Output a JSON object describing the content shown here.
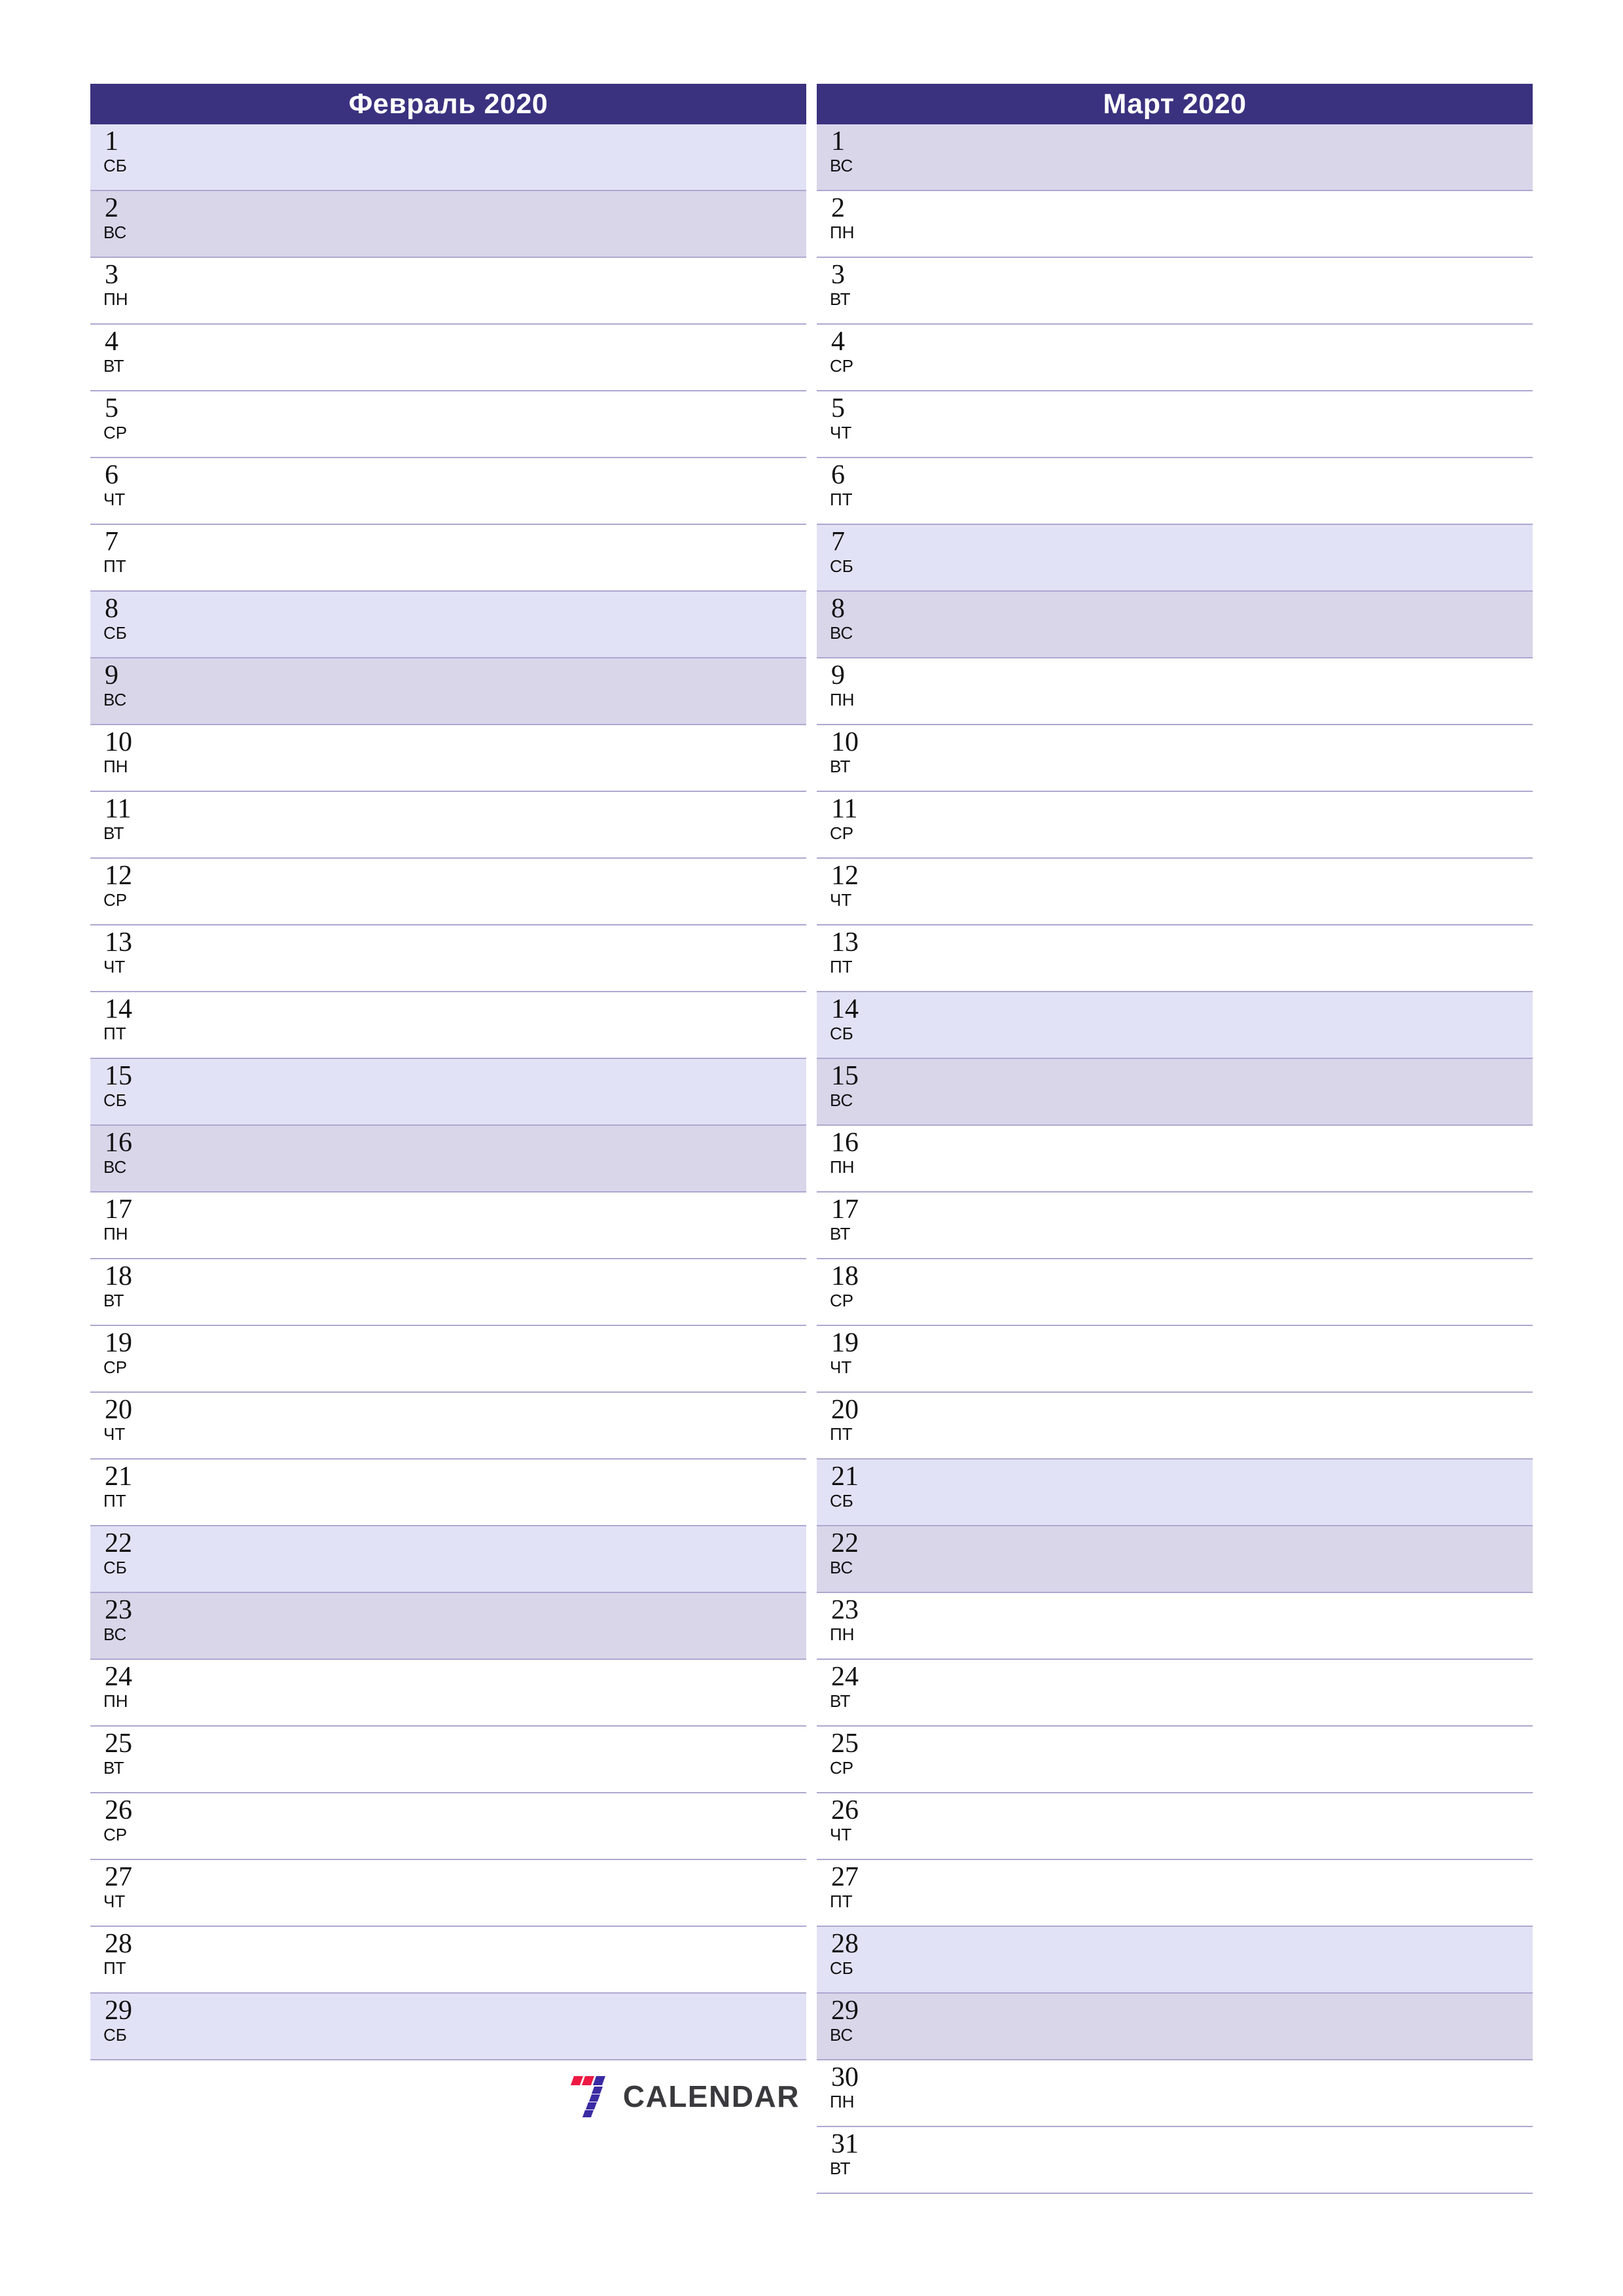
{
  "page": {
    "orientation": "portrait",
    "background_color": "#FFFFFF"
  },
  "theme": {
    "header_background": "#3A327F",
    "header_text_color": "#FFFFFF",
    "saturday_background": "#E2E2F6",
    "sunday_background": "#D9D6EA",
    "weekday_background": "#FFFFFF",
    "row_separator_color": "#ADA8CF",
    "day_text_color": "#111111",
    "logo_red": "#ED1944",
    "logo_purple": "#3B2BA3",
    "logo_word_color": "#3A3A3E"
  },
  "brand": {
    "mark_icon": "seven-stripes-icon",
    "word": "CALENDAR"
  },
  "months": [
    {
      "title": "Февраль 2020",
      "month_name": "Февраль",
      "year": "2020",
      "days": [
        {
          "num": "1",
          "dow": "СБ",
          "type": "sat"
        },
        {
          "num": "2",
          "dow": "ВС",
          "type": "sun"
        },
        {
          "num": "3",
          "dow": "ПН",
          "type": "weekday"
        },
        {
          "num": "4",
          "dow": "ВТ",
          "type": "weekday"
        },
        {
          "num": "5",
          "dow": "СР",
          "type": "weekday"
        },
        {
          "num": "6",
          "dow": "ЧТ",
          "type": "weekday"
        },
        {
          "num": "7",
          "dow": "ПТ",
          "type": "weekday"
        },
        {
          "num": "8",
          "dow": "СБ",
          "type": "sat"
        },
        {
          "num": "9",
          "dow": "ВС",
          "type": "sun"
        },
        {
          "num": "10",
          "dow": "ПН",
          "type": "weekday"
        },
        {
          "num": "11",
          "dow": "ВТ",
          "type": "weekday"
        },
        {
          "num": "12",
          "dow": "СР",
          "type": "weekday"
        },
        {
          "num": "13",
          "dow": "ЧТ",
          "type": "weekday"
        },
        {
          "num": "14",
          "dow": "ПТ",
          "type": "weekday"
        },
        {
          "num": "15",
          "dow": "СБ",
          "type": "sat"
        },
        {
          "num": "16",
          "dow": "ВС",
          "type": "sun"
        },
        {
          "num": "17",
          "dow": "ПН",
          "type": "weekday"
        },
        {
          "num": "18",
          "dow": "ВТ",
          "type": "weekday"
        },
        {
          "num": "19",
          "dow": "СР",
          "type": "weekday"
        },
        {
          "num": "20",
          "dow": "ЧТ",
          "type": "weekday"
        },
        {
          "num": "21",
          "dow": "ПТ",
          "type": "weekday"
        },
        {
          "num": "22",
          "dow": "СБ",
          "type": "sat"
        },
        {
          "num": "23",
          "dow": "ВС",
          "type": "sun"
        },
        {
          "num": "24",
          "dow": "ПН",
          "type": "weekday"
        },
        {
          "num": "25",
          "dow": "ВТ",
          "type": "weekday"
        },
        {
          "num": "26",
          "dow": "СР",
          "type": "weekday"
        },
        {
          "num": "27",
          "dow": "ЧТ",
          "type": "weekday"
        },
        {
          "num": "28",
          "dow": "ПТ",
          "type": "weekday"
        },
        {
          "num": "29",
          "dow": "СБ",
          "type": "sat"
        }
      ]
    },
    {
      "title": "Март 2020",
      "month_name": "Март",
      "year": "2020",
      "days": [
        {
          "num": "1",
          "dow": "ВС",
          "type": "sun"
        },
        {
          "num": "2",
          "dow": "ПН",
          "type": "weekday"
        },
        {
          "num": "3",
          "dow": "ВТ",
          "type": "weekday"
        },
        {
          "num": "4",
          "dow": "СР",
          "type": "weekday"
        },
        {
          "num": "5",
          "dow": "ЧТ",
          "type": "weekday"
        },
        {
          "num": "6",
          "dow": "ПТ",
          "type": "weekday"
        },
        {
          "num": "7",
          "dow": "СБ",
          "type": "sat"
        },
        {
          "num": "8",
          "dow": "ВС",
          "type": "sun"
        },
        {
          "num": "9",
          "dow": "ПН",
          "type": "weekday"
        },
        {
          "num": "10",
          "dow": "ВТ",
          "type": "weekday"
        },
        {
          "num": "11",
          "dow": "СР",
          "type": "weekday"
        },
        {
          "num": "12",
          "dow": "ЧТ",
          "type": "weekday"
        },
        {
          "num": "13",
          "dow": "ПТ",
          "type": "weekday"
        },
        {
          "num": "14",
          "dow": "СБ",
          "type": "sat"
        },
        {
          "num": "15",
          "dow": "ВС",
          "type": "sun"
        },
        {
          "num": "16",
          "dow": "ПН",
          "type": "weekday"
        },
        {
          "num": "17",
          "dow": "ВТ",
          "type": "weekday"
        },
        {
          "num": "18",
          "dow": "СР",
          "type": "weekday"
        },
        {
          "num": "19",
          "dow": "ЧТ",
          "type": "weekday"
        },
        {
          "num": "20",
          "dow": "ПТ",
          "type": "weekday"
        },
        {
          "num": "21",
          "dow": "СБ",
          "type": "sat"
        },
        {
          "num": "22",
          "dow": "ВС",
          "type": "sun"
        },
        {
          "num": "23",
          "dow": "ПН",
          "type": "weekday"
        },
        {
          "num": "24",
          "dow": "ВТ",
          "type": "weekday"
        },
        {
          "num": "25",
          "dow": "СР",
          "type": "weekday"
        },
        {
          "num": "26",
          "dow": "ЧТ",
          "type": "weekday"
        },
        {
          "num": "27",
          "dow": "ПТ",
          "type": "weekday"
        },
        {
          "num": "28",
          "dow": "СБ",
          "type": "sat"
        },
        {
          "num": "29",
          "dow": "ВС",
          "type": "sun"
        },
        {
          "num": "30",
          "dow": "ПН",
          "type": "weekday"
        },
        {
          "num": "31",
          "dow": "ВТ",
          "type": "weekday"
        }
      ]
    }
  ]
}
